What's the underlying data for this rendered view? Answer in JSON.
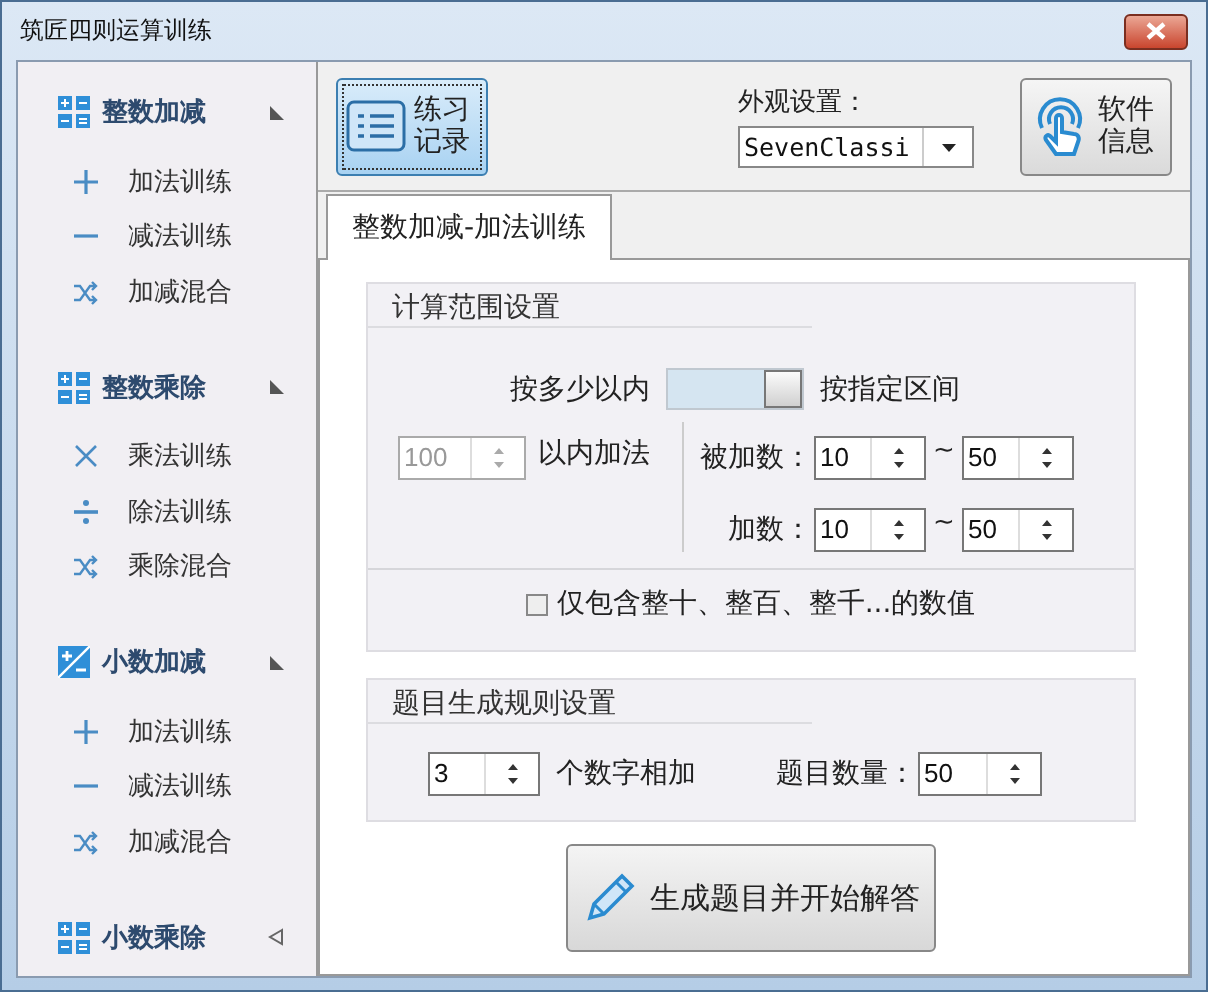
{
  "window": {
    "title": "筑匠四则运算训练"
  },
  "sidebar": {
    "groups": [
      {
        "label": "整数加减",
        "kind": "grid",
        "expanded": true,
        "items": [
          {
            "label": "加法训练",
            "kind": "add"
          },
          {
            "label": "减法训练",
            "kind": "subtract"
          },
          {
            "label": "加减混合",
            "kind": "mixed"
          }
        ]
      },
      {
        "label": "整数乘除",
        "kind": "grid",
        "expanded": true,
        "items": [
          {
            "label": "乘法训练",
            "kind": "multiply"
          },
          {
            "label": "除法训练",
            "kind": "divide"
          },
          {
            "label": "乘除混合",
            "kind": "mixed"
          }
        ]
      },
      {
        "label": "小数加减",
        "kind": "tile",
        "expanded": true,
        "items": [
          {
            "label": "加法训练",
            "kind": "add"
          },
          {
            "label": "减法训练",
            "kind": "subtract"
          },
          {
            "label": "加减混合",
            "kind": "mixed"
          }
        ]
      },
      {
        "label": "小数乘除",
        "kind": "grid",
        "expanded": false
      }
    ]
  },
  "toolbar": {
    "record_button": {
      "label": "练习记录"
    },
    "theme": {
      "label": "外观设置：",
      "value": "SevenClassi"
    },
    "info_button": {
      "label": "软件信息"
    }
  },
  "tabs": [
    {
      "label": "整数加减-加法训练",
      "selected": true
    }
  ],
  "range_settings": {
    "title": "计算范围设置",
    "mode_left_label": "按多少以内",
    "mode_toggle": {
      "on": true
    },
    "mode_right_label": "按指定区间",
    "limit": {
      "value": "100",
      "disabled": true
    },
    "limit_suffix": "以内加法",
    "ranges": [
      {
        "label": "被加数：",
        "from": "10",
        "separator": "~",
        "to": "50"
      },
      {
        "label": "加数：",
        "from": "10",
        "separator": "~",
        "to": "50"
      }
    ],
    "round_only": {
      "label": "仅包含整十、整百、整千...的数值",
      "checked": false
    }
  },
  "generation": {
    "title": "题目生成规则设置",
    "count": "3",
    "count_suffix": "个数字相加",
    "total_label": "题目数量：",
    "total": "50"
  },
  "start_button": {
    "label": "生成题目并开始解答"
  }
}
